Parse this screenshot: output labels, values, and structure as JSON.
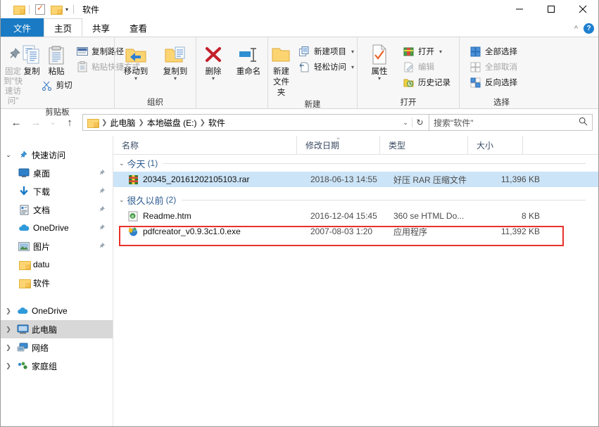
{
  "window": {
    "title": "软件",
    "quick_access": [
      "folder-icon",
      "checkbox-properties-icon",
      "folder-new-icon"
    ],
    "minimize": "—",
    "maximize": "□",
    "close": "✕"
  },
  "tabs": [
    {
      "label": "文件",
      "kind": "file"
    },
    {
      "label": "主页",
      "kind": "active"
    },
    {
      "label": "共享",
      "kind": "normal"
    },
    {
      "label": "查看",
      "kind": "normal"
    }
  ],
  "ribbon": {
    "collapse_label": "^",
    "help_label": "?",
    "groups": [
      {
        "name": "剪贴板",
        "big_buttons": [
          {
            "label": "固定到\"快速访问\"",
            "icon": "pin-icon",
            "disabled": true
          },
          {
            "label": "复制",
            "icon": "copy-icon",
            "disabled": false
          },
          {
            "label": "粘贴",
            "icon": "paste-icon",
            "disabled": false
          }
        ],
        "small_buttons": [
          {
            "label": "复制路径",
            "icon": "copy-path-icon",
            "disabled": false
          },
          {
            "label": "粘贴快捷方式",
            "icon": "paste-shortcut-icon",
            "disabled": true
          }
        ],
        "extra_button": {
          "label": "剪切",
          "icon": "scissors-icon"
        }
      },
      {
        "name": "组织",
        "big_buttons": [
          {
            "label": "移动到",
            "icon": "move-to-icon",
            "caret": true
          },
          {
            "label": "复制到",
            "icon": "copy-to-icon",
            "caret": true
          },
          {
            "label": "删除",
            "icon": "delete-x-icon",
            "caret": true
          },
          {
            "label": "重命名",
            "icon": "rename-icon",
            "caret": false
          }
        ]
      },
      {
        "name": "新建",
        "big_buttons": [
          {
            "label": "新建文件夹",
            "icon": "new-folder-icon",
            "caret": false
          }
        ],
        "small_buttons": [
          {
            "label": "新建项目",
            "icon": "new-item-icon",
            "caret": true
          },
          {
            "label": "轻松访问",
            "icon": "easy-access-icon",
            "caret": true
          }
        ]
      },
      {
        "name": "打开",
        "big_buttons": [
          {
            "label": "属性",
            "icon": "properties-icon",
            "caret": true
          }
        ],
        "small_buttons": [
          {
            "label": "打开",
            "icon": "open-icon",
            "caret": true,
            "disabled": false
          },
          {
            "label": "编辑",
            "icon": "edit-icon",
            "caret": false,
            "disabled": true
          },
          {
            "label": "历史记录",
            "icon": "history-icon",
            "caret": false,
            "disabled": false
          }
        ]
      },
      {
        "name": "选择",
        "small_buttons": [
          {
            "label": "全部选择",
            "icon": "select-all-icon",
            "disabled": false
          },
          {
            "label": "全部取消",
            "icon": "select-none-icon",
            "disabled": true
          },
          {
            "label": "反向选择",
            "icon": "invert-selection-icon",
            "disabled": false
          }
        ]
      }
    ]
  },
  "address": {
    "back": "←",
    "forward": "→",
    "recent": "⌄",
    "up": "↑",
    "crumbs": [
      "此电脑",
      "本地磁盘 (E:)",
      "软件"
    ],
    "dropdown": "⌄",
    "refresh": "↻",
    "search_placeholder": "搜索\"软件\""
  },
  "nav_pane": {
    "items": [
      {
        "label": "快速访问",
        "icon": "pin-star-icon",
        "chevron": "open",
        "indent": 0,
        "pinned": false,
        "selected": false
      },
      {
        "label": "桌面",
        "icon": "desktop-icon",
        "chevron": "none",
        "indent": 1,
        "pinned": true,
        "selected": false
      },
      {
        "label": "下载",
        "icon": "downloads-icon",
        "chevron": "none",
        "indent": 1,
        "pinned": true,
        "selected": false
      },
      {
        "label": "文档",
        "icon": "documents-icon",
        "chevron": "none",
        "indent": 1,
        "pinned": true,
        "selected": false
      },
      {
        "label": "OneDrive",
        "icon": "onedrive-cloud-icon",
        "chevron": "none",
        "indent": 1,
        "pinned": true,
        "selected": false
      },
      {
        "label": "图片",
        "icon": "pictures-icon",
        "chevron": "none",
        "indent": 1,
        "pinned": true,
        "selected": false
      },
      {
        "label": "datu",
        "icon": "folder-icon",
        "chevron": "none",
        "indent": 1,
        "pinned": false,
        "selected": false
      },
      {
        "label": "软件",
        "icon": "folder-icon",
        "chevron": "none",
        "indent": 1,
        "pinned": false,
        "selected": false
      },
      {
        "label": "OneDrive",
        "icon": "onedrive-cloud-icon",
        "chevron": "closed",
        "indent": 0,
        "pinned": false,
        "selected": false
      },
      {
        "label": "此电脑",
        "icon": "this-pc-icon",
        "chevron": "closed",
        "indent": 0,
        "pinned": false,
        "selected": true
      },
      {
        "label": "网络",
        "icon": "network-icon",
        "chevron": "closed",
        "indent": 0,
        "pinned": false,
        "selected": false
      },
      {
        "label": "家庭组",
        "icon": "homegroup-icon",
        "chevron": "closed",
        "indent": 0,
        "pinned": false,
        "selected": false
      }
    ]
  },
  "file_list": {
    "columns": [
      {
        "label": "名称",
        "sorted": false
      },
      {
        "label": "修改日期",
        "sorted": true
      },
      {
        "label": "类型",
        "sorted": false
      },
      {
        "label": "大小",
        "sorted": false
      }
    ],
    "groups": [
      {
        "name": "今天",
        "count": "(1)",
        "rows": [
          {
            "name": "20345_20161202105103.rar",
            "date": "2018-06-13 14:55",
            "type": "好压 RAR 压缩文件",
            "size": "11,396 KB",
            "icon": "rar-archive-icon",
            "selected": true,
            "highlighted": false
          }
        ]
      },
      {
        "name": "很久以前",
        "count": "(2)",
        "rows": [
          {
            "name": "Readme.htm",
            "date": "2016-12-04 15:45",
            "type": "360 se HTML Do...",
            "size": "8 KB",
            "icon": "html-document-icon",
            "selected": false,
            "highlighted": false
          },
          {
            "name": "pdfcreator_v0.9.3c1.0.exe",
            "date": "2007-08-03 1:20",
            "type": "应用程序",
            "size": "11,392 KB",
            "icon": "application-exe-icon",
            "selected": false,
            "highlighted": true
          }
        ]
      }
    ]
  },
  "colors": {
    "accent": "#1a7bc4",
    "selection": "#cce4f7",
    "highlight_box": "#e8312a",
    "group_header_text": "#2c5a8f"
  }
}
